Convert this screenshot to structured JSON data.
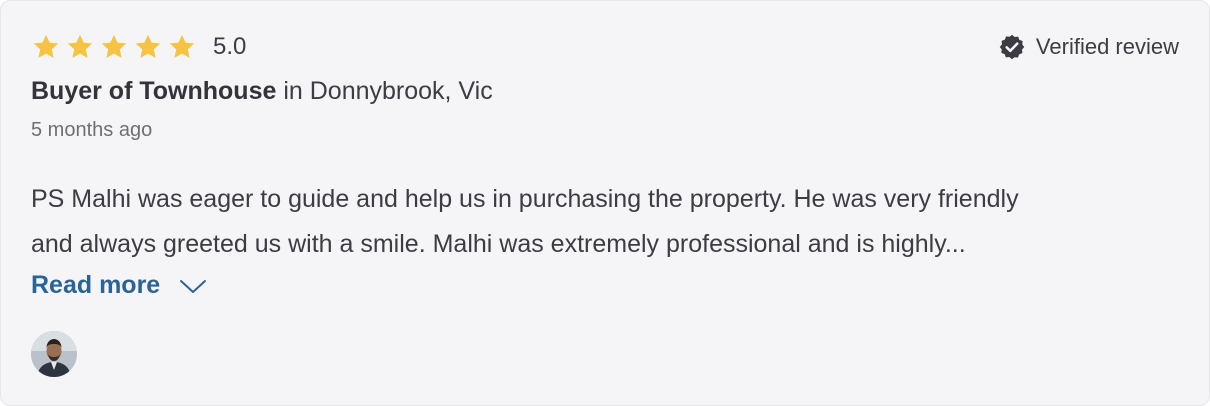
{
  "review": {
    "rating": 5,
    "rating_label": "5.0",
    "verified_label": "Verified review",
    "buyer_role": "Buyer of Townhouse",
    "location": "in Donnybrook, Vic",
    "time_ago": "5 months ago",
    "text_line1": "PS Malhi was eager to guide and help us in purchasing the property. He was very friendly",
    "text_line2": "and always greeted us with a smile. Malhi was extremely professional and is highly...",
    "read_more_label": "Read more"
  },
  "colors": {
    "star": "#f6c343",
    "link": "#2a6496",
    "card_bg": "#f5f5f7",
    "text": "#3c3c44",
    "muted": "#6e6e76"
  },
  "icons": {
    "star": "star-icon",
    "verified": "verified-badge-icon",
    "chevron": "chevron-down-icon"
  }
}
